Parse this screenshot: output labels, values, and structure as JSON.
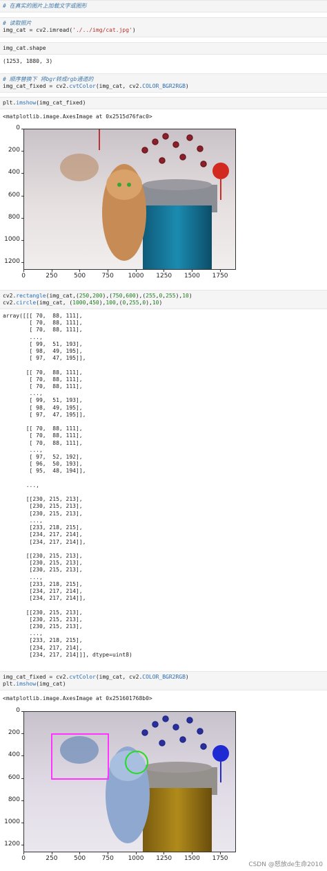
{
  "cells": {
    "c1": "# 在真实的图片上加载文字或图形",
    "c2_comment": "# 读取照片",
    "c2_code": "img_cat = cv2.imread('./../img/cat.jpg')",
    "c3": "img_cat.shape",
    "c3_out": "(1253, 1880, 3)",
    "c4_comment": "# 顺序替换下 将bgr转成rgb通道的",
    "c4_code": "img_cat_fixed = cv2.cvtColor(img_cat, cv2.COLOR_BGR2RGB)",
    "c5": "plt.imshow(img_cat_fixed)",
    "c5_out": "<matplotlib.image.AxesImage at 0x2515d76fac0>",
    "c6_line1": "cv2.rectangle(img_cat,(250,200),(750,600),(255,0,255),10)",
    "c6_line2": "cv2.circle(img_cat, (1000,450),100,(0,255,0),10)",
    "array_out": "array([[[ 70,  88, 111],\n        [ 70,  88, 111],\n        [ 70,  88, 111],\n        ...,\n        [ 99,  51, 193],\n        [ 98,  49, 195],\n        [ 97,  47, 195]],\n\n       [[ 70,  88, 111],\n        [ 70,  88, 111],\n        [ 70,  88, 111],\n        ...,\n        [ 99,  51, 193],\n        [ 98,  49, 195],\n        [ 97,  47, 195]],\n\n       [[ 70,  88, 111],\n        [ 70,  88, 111],\n        [ 70,  88, 111],\n        ...,\n        [ 97,  52, 192],\n        [ 96,  50, 193],\n        [ 95,  48, 194]],\n\n       ...,\n\n       [[230, 215, 213],\n        [230, 215, 213],\n        [230, 215, 213],\n        ...,\n        [233, 218, 215],\n        [234, 217, 214],\n        [234, 217, 214]],\n\n       [[230, 215, 213],\n        [230, 215, 213],\n        [230, 215, 213],\n        ...,\n        [233, 218, 215],\n        [234, 217, 214],\n        [234, 217, 214]],\n\n       [[230, 215, 213],\n        [230, 215, 213],\n        [230, 215, 213],\n        ...,\n        [233, 218, 215],\n        [234, 217, 214],\n        [234, 217, 214]]], dtype=uint8)",
    "c7_line1": "img_cat_fixed = cv2.cvtColor(img_cat, cv2.COLOR_BGR2RGB)",
    "c7_line2": "plt.imshow(img_cat)",
    "c7_out": "<matplotlib.image.AxesImage at 0x251601768b0>"
  },
  "axes_ticks": {
    "y": [
      "0",
      "200",
      "400",
      "600",
      "800",
      "1000",
      "1200"
    ],
    "x": [
      "0",
      "250",
      "500",
      "750",
      "1000",
      "1250",
      "1500",
      "1750"
    ]
  },
  "watermark": "CSDN @怒放de生命2010"
}
